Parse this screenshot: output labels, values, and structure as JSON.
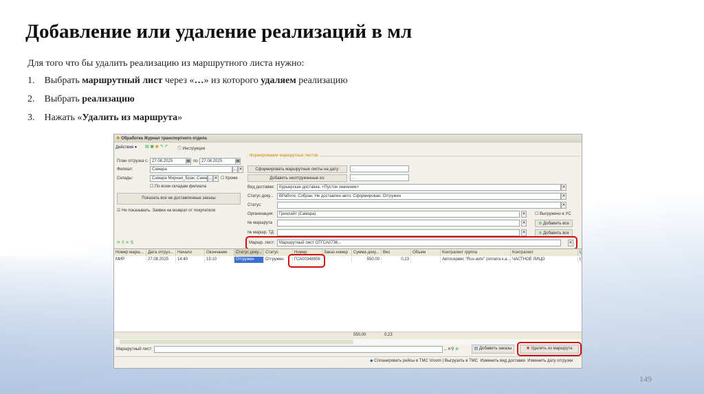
{
  "slide": {
    "title": "Добавление или удаление реализаций в мл",
    "intro": "Для того что бы удалить реализацию из маршрутного листа нужно:",
    "steps": [
      {
        "n": "1.",
        "pre": "Выбрать ",
        "b1": "маршрутный лист",
        "mid": " через «",
        "b2": "…",
        "mid2": "» из которого ",
        "b3": "удаляем",
        "post": " реализацию"
      },
      {
        "n": "2.",
        "pre": "Выбрать ",
        "b1": "реализацию"
      },
      {
        "n": "3.",
        "pre": "Нажать «",
        "b1": "Удалить из маршрута",
        "post": "»"
      }
    ],
    "page_number": "149"
  },
  "window": {
    "title": "Обработка Журнал транспортного отдела",
    "toolbar": {
      "actions": "Действия",
      "help": "Инструкция"
    },
    "left": {
      "plan_label": "План отгрузка с:",
      "date_from": "27.08.2025",
      "to_label": "по",
      "date_to": "27.08.2025",
      "branch_label": "Филиал:",
      "branch": "Самара",
      "warehouses_label": "Склады:",
      "warehouses": "Самара Мирная_Брак; Самар",
      "except_label": "Кроме",
      "all_wh_label": "По всем складам филиала",
      "show_btn": "Показать все не доставленные заказы",
      "no_return_label": "Не показывать. Заявки на возврат от покупателя"
    },
    "right": {
      "group": "Формирование маршрутных листов",
      "form_btn": "Сформировать маршрутные листы на дату:",
      "add_btn": "Добавить неотгруженные из:",
      "date_empty": ". .",
      "delivery_label": "Вид доставки:",
      "delivery": "Курьерская доставка; <Пустое значение>",
      "docstatus_label": "Статус доку...",
      "docstatus": "ВРаботе; Собран; Не доставлен авто; Сформирован; Отгружен",
      "status_label": "Статус:",
      "org_label": "Организация:",
      "org": "Гринлайт (Самара)",
      "uploaded_label": "Выгружено в УС",
      "route_label": "№ маршрута",
      "route_td_label": "№ маршр. ТД",
      "add_all": "Добавить все",
      "sheet_label": "Маршр. лист:",
      "sheet": "Маршрутный лист ОТГСА0736..."
    },
    "grid": {
      "columns": [
        "Номер марш...",
        "Дата отгруз...",
        "Начало",
        "Окончание",
        "Статус доку...",
        "Статус",
        "Номер",
        "Заказ номер",
        "Сумма доку...",
        "Вес",
        "Объем",
        "Контрагент группа",
        "Контрагент",
        "Ш"
      ],
      "rows": [
        [
          "МИР",
          "27.08.2025",
          "14:40",
          "15:10",
          "Отгружен",
          "Отгружен",
          "ГСА00348956",
          "",
          "550,00",
          "0,23",
          "",
          "Автосервис \"Rus-avto\" (оплата к.а...",
          "ЧАСТНОЕ ЛИЦО",
          "Ш"
        ]
      ],
      "totals": {
        "sum": "550,00",
        "weight": "0,23"
      }
    },
    "bottom": {
      "sheet_label": "Маршрутный лист:",
      "add_orders": "Добавить заказы",
      "remove": "Удалить из маршрута"
    },
    "status": {
      "plan": "Спланировать рейсы в ТМС Vroom",
      "export": "Выгрузить в ТМС",
      "change_delivery": "Изменить вид доставки",
      "change_date": "Изменить дату отгрузки"
    }
  }
}
